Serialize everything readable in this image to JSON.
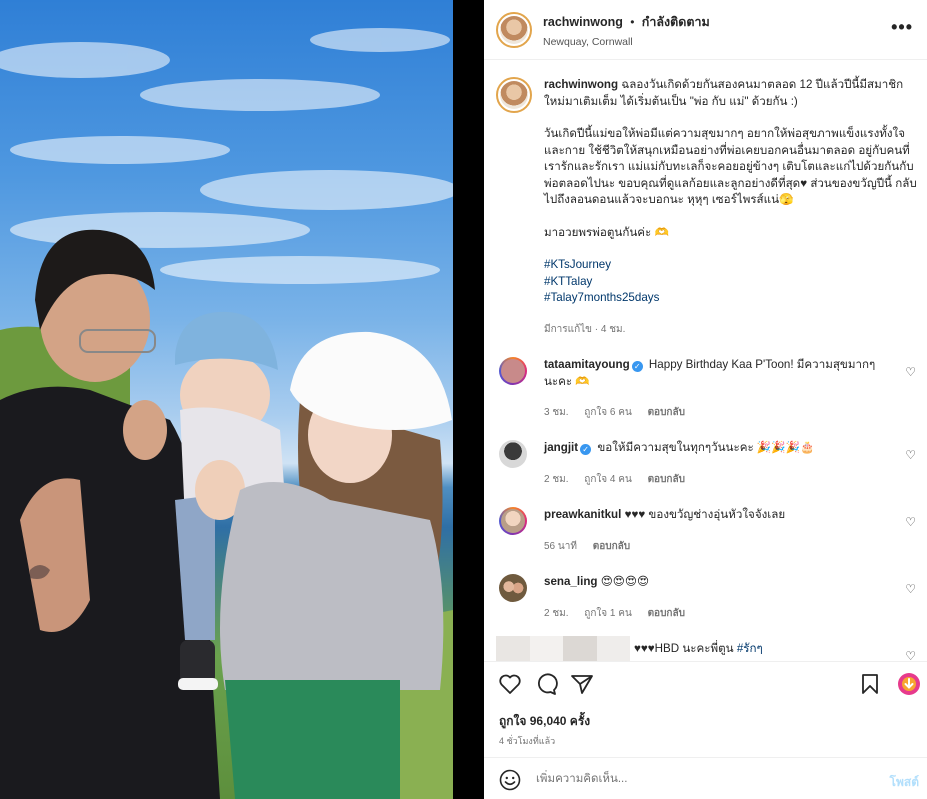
{
  "post": {
    "username": "rachwinwong",
    "follow_status": "กำลังติดตาม",
    "location": "Newquay, Cornwall",
    "more_label": "•••"
  },
  "caption": {
    "username": "rachwinwong",
    "p1": "ฉลองวันเกิดด้วยกันสองคนมาตลอด 12 ปีแล้วปีนี้มีสมาชิกใหม่มาเติมเต็ม ได้เริ่มต้นเป็น \"พ่อ กับ แม่\" ด้วยกัน :)",
    "p2": "วันเกิดปีนี้แม่ขอให้พ่อมีแต่ความสุขมากๆ อยากให้พ่อสุขภาพแข็งแรงทั้งใจและกาย ใช้ชีวิตให้สนุกเหมือนอย่างที่พ่อเคยบอกคนอื่นมาตลอด อยู่กับคนที่เรารักและรักเรา แม่แม่กับทะเลก็จะคอยอยู่ข้างๆ เติบโตและแก่ไปด้วยกันกับพ่อตลอดไปนะ ขอบคุณที่ดูแลก้อยและลูกอย่างดีที่สุด♥ ส่วนของขวัญปีนี้ กลับไปถึงลอนดอนแล้วจะบอกนะ หุหุๆ เซอร์ไพรส์แน่🫣",
    "p3": "มาอวยพรพ่อตูนกันค่ะ 🫶",
    "hashtags": [
      "#KTsJourney",
      "#KTTalay",
      "#Talay7months25days"
    ],
    "edited": "มีการแก้ไข · 4 ชม."
  },
  "comments": [
    {
      "username": "tataamitayoung",
      "verified": true,
      "text": "Happy Birthday Kaa P'Toon! มีความสุขมากๆ นะคะ 🫶",
      "time": "3 ชม.",
      "likes": "ถูกใจ 6 คน",
      "reply": "ตอบกลับ"
    },
    {
      "username": "jangjit",
      "verified": true,
      "text": "ขอให้มีความสุขในทุกๆวันนะคะ 🎉🎉🎉🎂",
      "time": "2 ชม.",
      "likes": "ถูกใจ 4 คน",
      "reply": "ตอบกลับ"
    },
    {
      "username": "preawkanitkul",
      "verified": false,
      "text": "♥♥♥ ของขวัญช่างอุ่นหัวใจจังเลย",
      "time": "56 นาที",
      "likes": "",
      "reply": "ตอบกลับ"
    },
    {
      "username": "sena_ling",
      "verified": false,
      "text": "😍😍😍😍",
      "time": "2 ชม.",
      "likes": "ถูกใจ 1 คน",
      "reply": "ตอบกลับ"
    },
    {
      "username": "",
      "verified": false,
      "text": "♥♥♥HBD นะคะพี่ตูน ",
      "tag": "#รักๆ",
      "time": "",
      "likes": "",
      "reply": ""
    }
  ],
  "stats": {
    "likes": "ถูกใจ 96,040 ครั้ง",
    "time_ago": "4 ชั่วโมงที่แล้ว"
  },
  "add_comment": {
    "placeholder": "เพิ่มความคิดเห็น...",
    "post_label": "โพสต์"
  }
}
